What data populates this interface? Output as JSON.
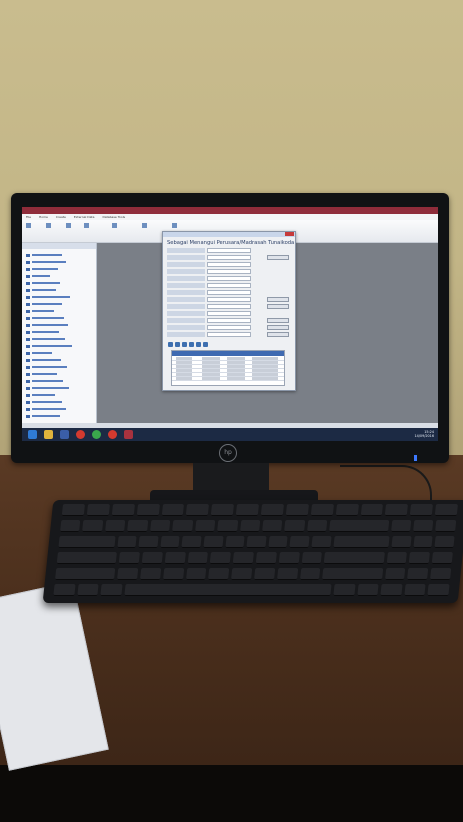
{
  "scene": {
    "wall_color": "#c4b788",
    "desk_color": "#4e321f",
    "monitor_brand_logo": "hp-logo",
    "power_led_color": "#3d78ff"
  },
  "app": {
    "title": "",
    "accent": "#8e2c3a",
    "ribbon_tabs": [
      "File",
      "Home",
      "Create",
      "External Data",
      "Database Tools"
    ],
    "nav_header": ""
  },
  "dialog": {
    "title": "Sebagai Menangui Perusara/Madrasah Tunaikoda",
    "icon": "close-icon"
  },
  "taskbar": {
    "time": "15:24",
    "date": "14/09/2016",
    "icons": [
      "windows-start-icon",
      "file-explorer-icon",
      "media-icon",
      "opera-icon",
      "chrome-icon",
      "opera-icon",
      "access-icon"
    ]
  }
}
